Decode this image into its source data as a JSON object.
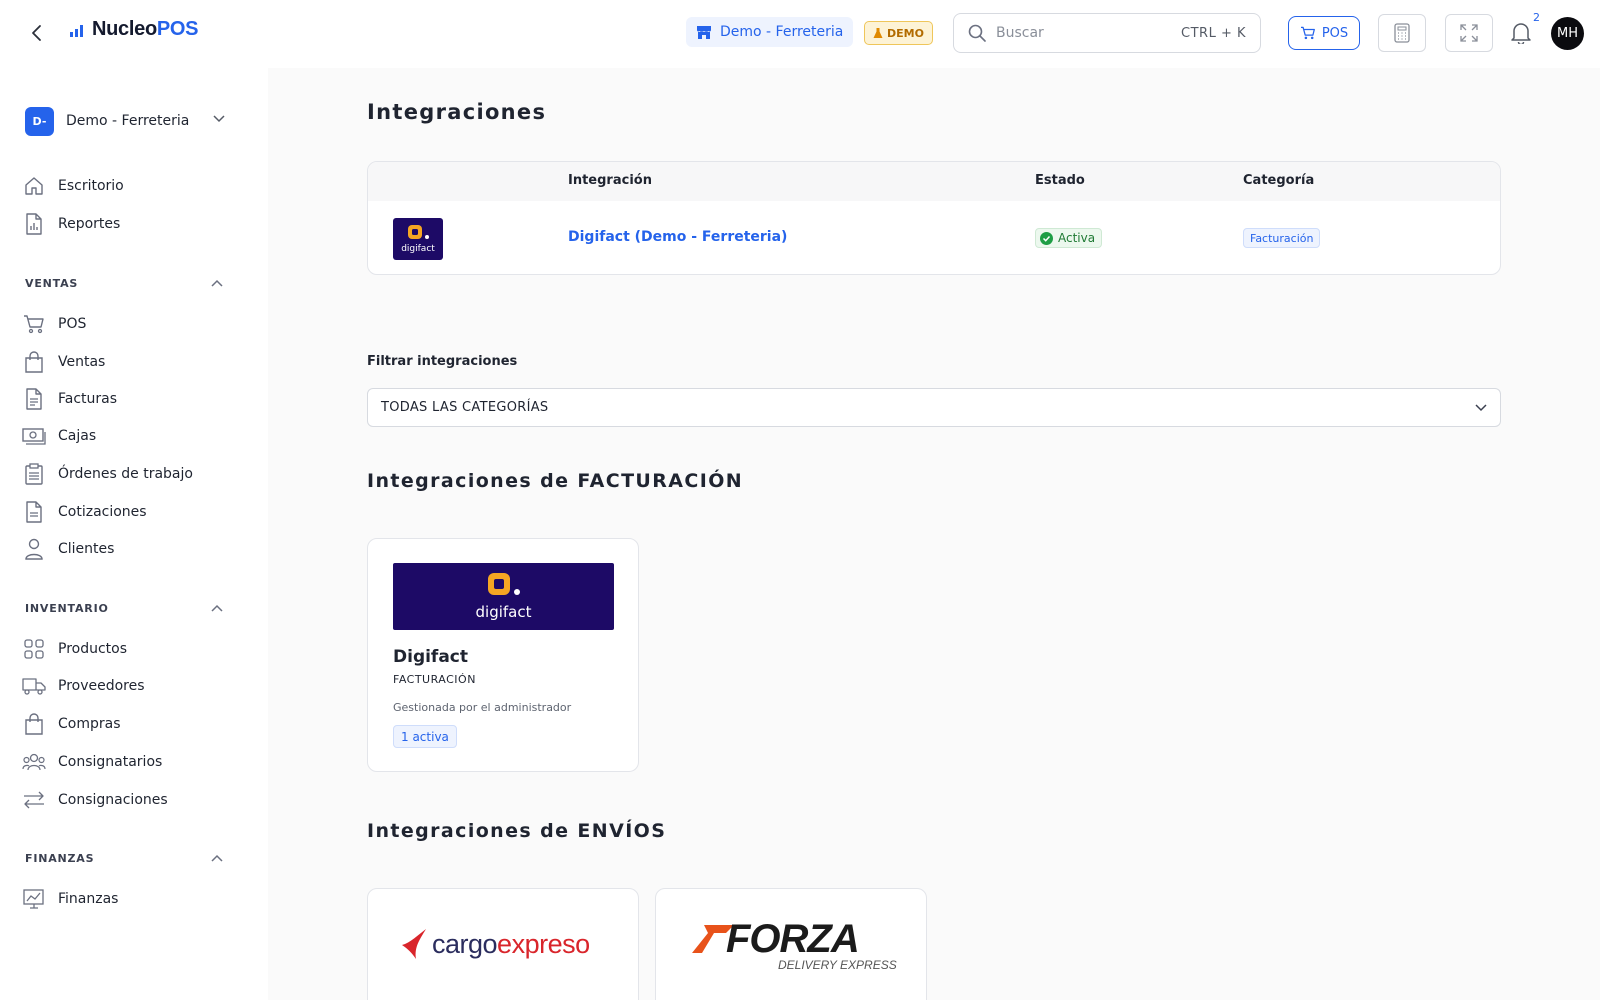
{
  "brand": {
    "name_main": "Nucleo",
    "name_accent": "POS"
  },
  "company": {
    "initials": "D-",
    "name": "Demo - Ferreteria"
  },
  "sidebar": {
    "top_items": [
      {
        "label": "Escritorio",
        "icon": "home-icon"
      },
      {
        "label": "Reportes",
        "icon": "report-icon"
      }
    ],
    "sections": [
      {
        "title": "VENTAS",
        "items": [
          {
            "label": "POS",
            "icon": "cart-icon"
          },
          {
            "label": "Ventas",
            "icon": "bag-icon"
          },
          {
            "label": "Facturas",
            "icon": "invoice-icon"
          },
          {
            "label": "Cajas",
            "icon": "cash-icon"
          },
          {
            "label": "Órdenes de trabajo",
            "icon": "clipboard-icon"
          },
          {
            "label": "Cotizaciones",
            "icon": "quote-icon"
          },
          {
            "label": "Clientes",
            "icon": "user-icon"
          }
        ]
      },
      {
        "title": "INVENTARIO",
        "items": [
          {
            "label": "Productos",
            "icon": "grid-icon"
          },
          {
            "label": "Proveedores",
            "icon": "truck-icon"
          },
          {
            "label": "Compras",
            "icon": "bag-icon"
          },
          {
            "label": "Consignatarios",
            "icon": "users-icon"
          },
          {
            "label": "Consignaciones",
            "icon": "swap-icon"
          }
        ]
      },
      {
        "title": "FINANZAS",
        "items": [
          {
            "label": "Finanzas",
            "icon": "chart-icon"
          }
        ]
      }
    ]
  },
  "topbar": {
    "store": "Demo - Ferreteria",
    "demo_badge": "DEMO",
    "search_placeholder": "Buscar",
    "search_shortcut": "CTRL + K",
    "pos_button": "POS",
    "notifications_count": "2",
    "avatar_initials": "MH"
  },
  "main": {
    "title": "Integraciones",
    "table": {
      "headers": [
        "Integración",
        "Estado",
        "Categoría"
      ],
      "rows": [
        {
          "logo_text": "digifact",
          "name": "Digifact (Demo - Ferreteria)",
          "status": "Activa",
          "category": "Facturación"
        }
      ]
    },
    "filter": {
      "label": "Filtrar integraciones",
      "selected": "TODAS LAS CATEGORÍAS"
    },
    "billing_section": {
      "title": "Integraciones de FACTURACIÓN",
      "cards": [
        {
          "logo_text": "digifact",
          "title": "Digifact",
          "category": "FACTURACIÓN",
          "managed": "Gestionada por el administrador",
          "count": "1 activa"
        }
      ]
    },
    "shipping_section": {
      "title": "Integraciones de ENVÍOS",
      "cards": [
        {
          "logo_main": "cargo",
          "logo_accent": "expreso"
        },
        {
          "logo_main": "FORZA",
          "logo_sub": "DELIVERY EXPRESS"
        }
      ]
    }
  },
  "colors": {
    "primary": "#2563eb",
    "digifact_bg": "#1d0a66",
    "digifact_accent": "#f5a623",
    "success": "#1f7a34",
    "demo": "#b26b00"
  }
}
